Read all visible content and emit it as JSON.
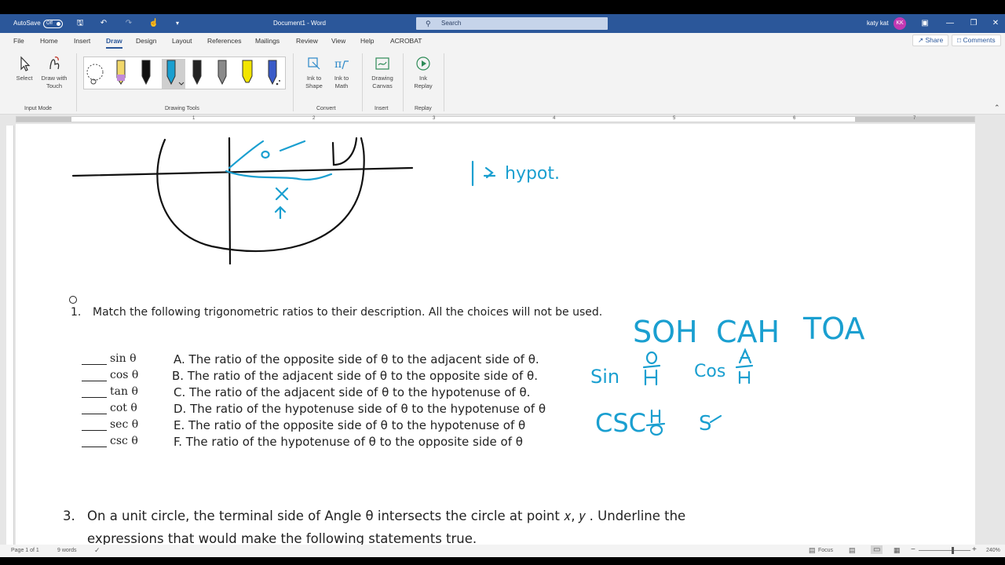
{
  "window": {
    "autosave_label": "AutoSave",
    "autosave_state": "Off",
    "doc_title": "Document1 - Word",
    "search_placeholder": "Search",
    "user_name": "katy kat",
    "user_initials": "KK"
  },
  "tabs": [
    "File",
    "Home",
    "Insert",
    "Draw",
    "Design",
    "Layout",
    "References",
    "Mailings",
    "Review",
    "View",
    "Help",
    "ACROBAT"
  ],
  "active_tab": "Draw",
  "share_label": "Share",
  "comments_label": "Comments",
  "ribbon": {
    "select_label": "Select",
    "draw_touch_label": "Draw with Touch",
    "input_mode_group": "Input Mode",
    "drawing_tools_group": "Drawing Tools",
    "ink_to_shape_label": "Ink to Shape",
    "ink_to_math_label": "Ink to Math",
    "convert_group": "Convert",
    "drawing_canvas_label": "Drawing Canvas",
    "insert_group": "Insert",
    "ink_replay_label": "Ink Replay",
    "replay_group": "Replay"
  },
  "pens": [
    {
      "name": "lasso-select-tool",
      "color": "#444444"
    },
    {
      "name": "pencil-tool",
      "color": "#c28ad8"
    },
    {
      "name": "black-pen",
      "color": "#000000"
    },
    {
      "name": "teal-pen",
      "color": "#1a9fd0"
    },
    {
      "name": "black-pen-2",
      "color": "#111111"
    },
    {
      "name": "grey-pen",
      "color": "#888888"
    },
    {
      "name": "yellow-highlighter",
      "color": "#f2e500"
    },
    {
      "name": "galaxy-pen",
      "color": "#3a5bc8"
    }
  ],
  "ruler_numbers": [
    "1",
    "2",
    "3",
    "4",
    "5",
    "6",
    "7"
  ],
  "document": {
    "q1_number": "1.",
    "q1_text": "Match the following trigonometric ratios to their description. All the choices will not be used.",
    "match_rows": [
      {
        "fn": "sin θ",
        "choice": "A. The ratio of the opposite side of θ to the adjacent side of θ."
      },
      {
        "fn": "cos θ",
        "choice": "B. The ratio of the adjacent side of θ to the opposite side of θ."
      },
      {
        "fn": "tan θ",
        "choice": "C. The ratio of the adjacent side of θ to the hypotenuse of θ."
      },
      {
        "fn": "cot θ",
        "choice": "D. The ratio of the hypotenuse side of θ to the hypotenuse of θ"
      },
      {
        "fn": "sec θ",
        "choice": "E.  The ratio of the opposite side of θ to the hypotenuse of θ"
      },
      {
        "fn": "csc θ",
        "choice": "F.  The ratio of the hypotenuse of θ to the opposite side of θ"
      }
    ],
    "q3_number": "3.",
    "q3_line1": "On a unit circle, the terminal side of Angle θ intersects the circle at point 𝑥, 𝑦 . Underline the",
    "q3_line2": "expressions that would make the following statements true."
  },
  "ink_notes": {
    "hypot": "hypot.",
    "soh": "SOH",
    "cah": "CAH",
    "toa": "TOA",
    "sin": "Sin",
    "cos": "Cos",
    "csc": "CSC",
    "s": "S"
  },
  "status": {
    "page": "Page 1 of 1",
    "words": "9 words",
    "focus": "Focus",
    "zoom": "240%"
  }
}
